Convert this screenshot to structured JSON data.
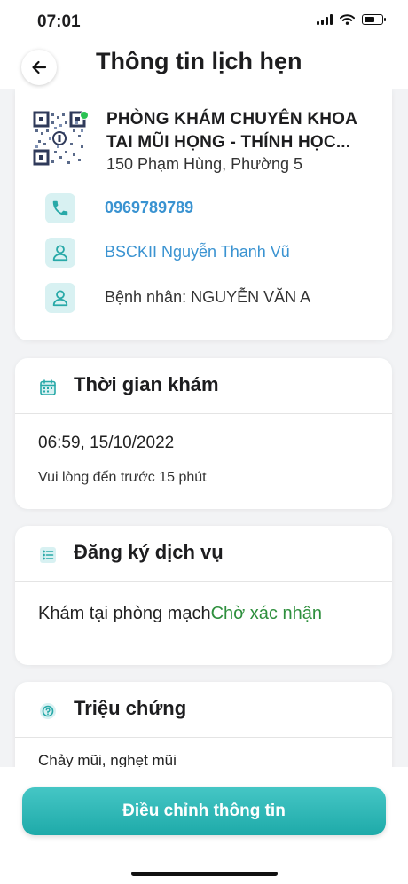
{
  "status_bar": {
    "time": "07:01"
  },
  "header": {
    "title": "Thông tin lịch hẹn"
  },
  "clinic": {
    "name": "PHÒNG KHÁM CHUYÊN KHOA TAI MŨI HỌNG - THÍNH HỌC...",
    "address": "150 Phạm Hùng, Phường 5",
    "phone": "0969789789",
    "doctor": "BSCKII Nguyễn Thanh Vũ",
    "patient": "Bệnh nhân: NGUYỄN VĂN A",
    "online_status_color": "#2bc253"
  },
  "exam_time": {
    "title": "Thời gian khám",
    "value": "06:59, 15/10/2022",
    "note": "Vui lòng đến trước 15 phút"
  },
  "service": {
    "title": "Đăng ký dịch vụ",
    "name": "Khám tại phòng mạch",
    "status": "Chờ xác nhận",
    "status_color": "#2e8f3d"
  },
  "symptoms": {
    "title": "Triệu chứng",
    "text": "Chảy mũi, nghẹt mũi"
  },
  "actions": {
    "edit_label": "Điều chỉnh thông tin"
  },
  "colors": {
    "accent": "#2bb3b2",
    "link": "#3a93d1",
    "icon_bg": "#d8f1f2"
  }
}
